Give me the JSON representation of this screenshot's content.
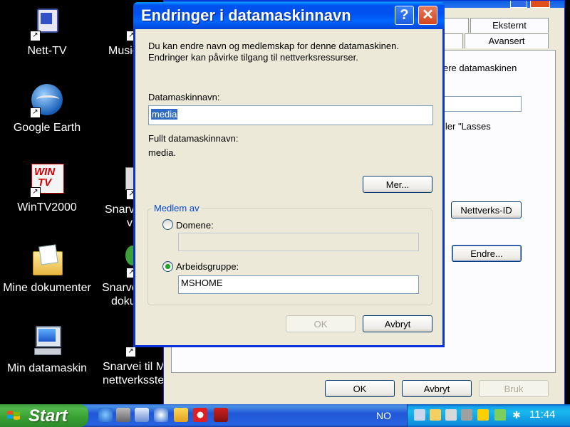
{
  "desktop": {
    "icons": [
      {
        "label": "Nett-TV"
      },
      {
        "label": "Google Earth"
      },
      {
        "label": "WinTV2000"
      },
      {
        "label": "Mine dokumenter"
      },
      {
        "label": "Min datamaskin"
      },
      {
        "label": "Music"
      },
      {
        "label": "Snarvei",
        "line2": "vi"
      },
      {
        "label": "Snarvei",
        "line2": "doku"
      },
      {
        "label": "Snarvei til M",
        "line2": "nettverksste"
      }
    ],
    "right_edge": {
      "et": "et",
      "m": "M"
    }
  },
  "background_window": {
    "tabs": {
      "eksternt": "Eksternt",
      "avansert": "Avansert"
    },
    "text1": "ere datamaskinen",
    "text2": "ller \"Lasses",
    "nettverks_id": "Nettverks-ID",
    "endre": "Endre...",
    "ok": "OK",
    "avbryt": "Avbryt",
    "bruk": "Bruk"
  },
  "dialog": {
    "title": "Endringer i datamaskinnavn",
    "help_glyph": "?",
    "close_glyph": "✕",
    "intro_line1": "Du kan endre navn og medlemskap for denne datamaskinen.",
    "intro_line2": "Endringer kan påvirke tilgang til nettverksressurser.",
    "computer_name_label": "Datamaskinnavn:",
    "computer_name_value": "media",
    "full_name_label": "Fullt datamaskinnavn:",
    "full_name_value": "media.",
    "more_button": "Mer...",
    "member_of_label": "Medlem av",
    "domain_label": "Domene:",
    "domain_value": "",
    "workgroup_label": "Arbeidsgruppe:",
    "workgroup_value": "MSHOME",
    "selected_option": "workgroup",
    "ok_button": "OK",
    "cancel_button": "Avbryt"
  },
  "taskbar": {
    "start_label": "Start",
    "language": "NO",
    "clock": "11:44"
  },
  "colors": {
    "titlebar_blue": "#0053ee",
    "close_red": "#d2461f",
    "start_green": "#3c9a3c",
    "taskbar_blue": "#2157d7",
    "dialog_face": "#ece9d8",
    "selection_blue": "#316ac5"
  }
}
